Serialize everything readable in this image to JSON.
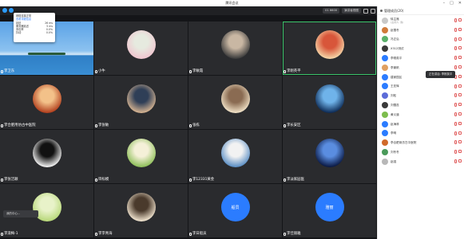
{
  "window": {
    "title": "腾讯会议"
  },
  "topbar": {
    "room_pill": "01 6600",
    "view_label": "演讲者视图"
  },
  "network_popup": {
    "title": "网络连接正常",
    "detail_link": "查看详细信息",
    "rows": [
      {
        "label": "延迟",
        "value": "26 ms"
      },
      {
        "label": "服务器延迟",
        "value": "5 ms"
      },
      {
        "label": "丢包率",
        "value": "0.0%"
      },
      {
        "label": "抖动",
        "value": "0.0%"
      }
    ]
  },
  "tiles": [
    {
      "name": "李卫东",
      "kind": "sea"
    },
    {
      "name": "小牛",
      "kind": "logo",
      "colors": [
        "#f0c6d0",
        "#e6eadf"
      ]
    },
    {
      "name": "李敏霞",
      "kind": "avatar",
      "colors": [
        "#3c3c3c",
        "#c9b7a3"
      ]
    },
    {
      "name": "李刚英平",
      "kind": "avatar",
      "colors": [
        "#f5d6a8",
        "#d8563a"
      ],
      "speaking": true
    },
    {
      "name": "李合肥用仿古中医院",
      "kind": "avatar",
      "colors": [
        "#b2401e",
        "#f3c189"
      ]
    },
    {
      "name": "李张敏",
      "kind": "avatar",
      "colors": [
        "#d5b391",
        "#2f3f57"
      ]
    },
    {
      "name": "张栋",
      "kind": "avatar",
      "colors": [
        "#f0e1c6",
        "#8a6b52"
      ]
    },
    {
      "name": "李长安区",
      "kind": "avatar",
      "colors": [
        "#0e2c57",
        "#6fb3ea"
      ]
    },
    {
      "name": "李张洁颖",
      "kind": "avatar",
      "colors": [
        "#f4f4f4",
        "#111111"
      ]
    },
    {
      "name": "目标模",
      "kind": "avatar",
      "colors": [
        "#8fbf5b",
        "#f5f0d8"
      ]
    },
    {
      "name": "李12331黄金",
      "kind": "avatar",
      "colors": [
        "#5c8fc4",
        "#f2f2f2"
      ]
    },
    {
      "name": "李淡家园医",
      "kind": "avatar",
      "colors": [
        "#0b1a45",
        "#5a8de0"
      ]
    },
    {
      "name": "李淑梅-1",
      "kind": "avatar",
      "colors": [
        "#b8d87a",
        "#e8f2c9"
      ]
    },
    {
      "name": "李李青海",
      "kind": "avatar",
      "colors": [
        "#f1e4cf",
        "#4a3a2c"
      ]
    },
    {
      "name": "李日船员",
      "kind": "text",
      "avatar_text": "船员"
    },
    {
      "name": "李佳丽雅",
      "kind": "text",
      "avatar_text": "雅丽"
    }
  ],
  "hud_label": "我的中心...",
  "panel": {
    "header": "管理成员(20)",
    "participants": [
      {
        "name": "徐主席",
        "sub": "(主持人, 我)",
        "color": "#c9c9c9"
      },
      {
        "name": "赵雪冬",
        "sub": "",
        "color": "#d07a3a"
      },
      {
        "name": "冯正弘",
        "sub": "",
        "color": "#5bb06a"
      },
      {
        "name": "X312测试",
        "sub": "",
        "color": "#3a3a3a"
      },
      {
        "name": "李刚英平",
        "sub": "",
        "color": "#2b7cff"
      },
      {
        "name": "李景帆",
        "sub": "",
        "color": "#e0a060"
      },
      {
        "name": "建家园区",
        "sub": "",
        "color": "#2b7cff"
      },
      {
        "name": "王亚辉",
        "sub": "",
        "color": "#2b7cff"
      },
      {
        "name": "刘松",
        "sub": "",
        "color": "#5c6cd8"
      },
      {
        "name": "刘雪蕊",
        "sub": "",
        "color": "#3a3a3a"
      },
      {
        "name": "黄义道",
        "sub": "",
        "color": "#7dbd4d"
      },
      {
        "name": "赵海林",
        "sub": "",
        "color": "#2b7cff"
      },
      {
        "name": "李明",
        "sub": "",
        "color": "#2b7cff"
      },
      {
        "name": "李合肥用仿古中医院",
        "sub": "",
        "color": "#d06a2a"
      },
      {
        "name": "刘冬冬",
        "sub": "",
        "color": "#4a9a5a"
      },
      {
        "name": "赵强",
        "sub": "",
        "color": "#b8b8b8"
      }
    ]
  },
  "tooltip": "正在讲话: 李刚英平"
}
